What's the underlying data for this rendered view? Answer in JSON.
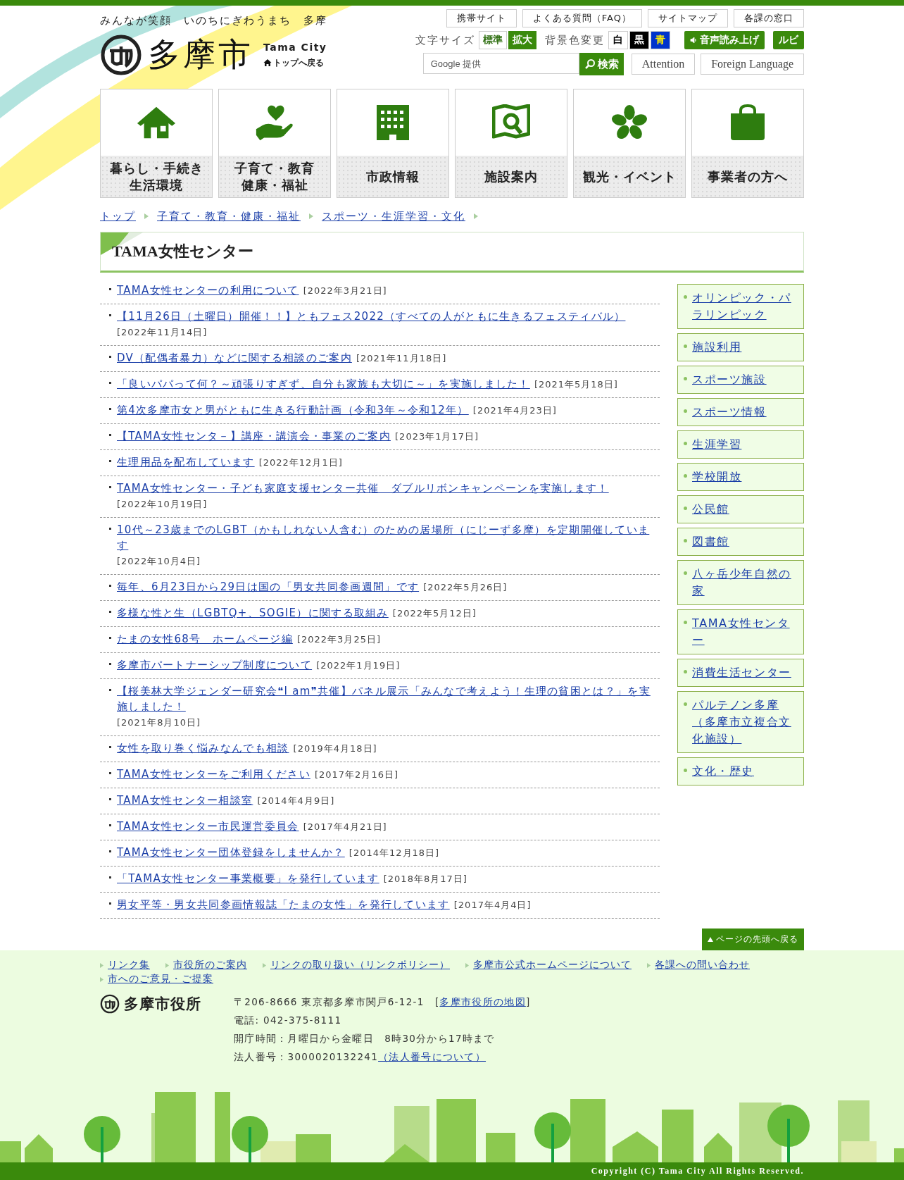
{
  "header": {
    "tagline": "みんなが笑顔　いのちにぎわうまち　多摩",
    "logo_text": "多摩市",
    "logo_sub": "Tama City",
    "home_link": "トップへ戻る",
    "top_links": [
      "携帯サイト",
      "よくある質問（FAQ）",
      "サイトマップ",
      "各課の窓口"
    ],
    "font_size": {
      "label": "文字サイズ",
      "options": [
        {
          "label": "標準",
          "selected": false
        },
        {
          "label": "拡大",
          "selected": true
        }
      ]
    },
    "bg_color": {
      "label": "背景色変更",
      "options": [
        {
          "label": "白",
          "color": "#ffffff"
        },
        {
          "label": "黒",
          "color": "#000000"
        },
        {
          "label": "青",
          "color": "#0033cc"
        }
      ]
    },
    "voice_button": "音声読み上げ",
    "ruby_button": "ルビ",
    "search": {
      "placeholder": "Google 提供",
      "button": "検索"
    },
    "extra_links": [
      "Attention",
      "Foreign Language"
    ]
  },
  "nav": [
    {
      "lines": [
        "暮らし・手続き",
        "生活環境"
      ]
    },
    {
      "lines": [
        "子育て・教育",
        "健康・福祉"
      ]
    },
    {
      "lines": [
        "市政情報"
      ]
    },
    {
      "lines": [
        "施設案内"
      ]
    },
    {
      "lines": [
        "観光・イベント"
      ]
    },
    {
      "lines": [
        "事業者の方へ"
      ]
    }
  ],
  "breadcrumb": [
    "トップ",
    "子育て・教育・健康・福祉",
    "スポーツ・生涯学習・文化"
  ],
  "page_title": "TAMA女性センター",
  "articles": [
    {
      "title": "TAMA女性センターの利用について",
      "date": "[2022年3月21日]"
    },
    {
      "title": "【11月26日（土曜日）開催！！】ともフェス2022（すべての人がともに生きるフェスティバル）",
      "date": "[2022年11月14日]"
    },
    {
      "title": "DV（配偶者暴力）などに関する相談のご案内",
      "date": "[2021年11月18日]"
    },
    {
      "title": "「良いパパって何？～頑張りすぎず、自分も家族も大切に～」を実施しました！",
      "date": "[2021年5月18日]"
    },
    {
      "title": "第4次多摩市女と男がともに生きる行動計画（令和3年～令和12年）",
      "date": "[2021年4月23日]"
    },
    {
      "title": "【TAMA女性センタ－】講座・講演会・事業のご案内",
      "date": "[2023年1月17日]"
    },
    {
      "title": "生理用品を配布しています",
      "date": "[2022年12月1日]"
    },
    {
      "title": "TAMA女性センター・子ども家庭支援センター共催　ダブルリボンキャンペーンを実施します！",
      "date": "[2022年10月19日]"
    },
    {
      "title": "10代～23歳までのLGBT（かもしれない人含む）のための居場所（にじーず多摩）を定期開催しています",
      "date": "[2022年10月4日]"
    },
    {
      "title": "毎年、6月23日から29日は国の「男女共同参画週間」です",
      "date": "[2022年5月26日]"
    },
    {
      "title": "多様な性と生（LGBTQ+、SOGIE）に関する取組み",
      "date": "[2022年5月12日]"
    },
    {
      "title": "たまの女性68号　ホームページ編",
      "date": "[2022年3月25日]"
    },
    {
      "title": "多摩市パートナーシップ制度について",
      "date": "[2022年1月19日]"
    },
    {
      "title": "【桜美林大学ジェンダー研究会❝I am❞共催】パネル展示「みんなで考えよう！生理の貧困とは？」を実施しました！",
      "date": "[2021年8月10日]"
    },
    {
      "title": "女性を取り巻く悩みなんでも相談",
      "date": "[2019年4月18日]"
    },
    {
      "title": "TAMA女性センターをご利用ください",
      "date": "[2017年2月16日]"
    },
    {
      "title": "TAMA女性センター相談室",
      "date": "[2014年4月9日]"
    },
    {
      "title": "TAMA女性センター市民運営委員会",
      "date": "[2017年4月21日]"
    },
    {
      "title": "TAMA女性センター団体登録をしませんか？",
      "date": "[2014年12月18日]"
    },
    {
      "title": "「TAMA女性センター事業概要」を発行しています",
      "date": "[2018年8月17日]"
    },
    {
      "title": "男女平等・男女共同参画情報誌「たまの女性」を発行しています",
      "date": "[2017年4月4日]"
    }
  ],
  "sidebar": [
    "オリンピック・パラリンピック",
    "施設利用",
    "スポーツ施設",
    "スポーツ情報",
    "生涯学習",
    "学校開放",
    "公民館",
    "図書館",
    "八ヶ岳少年自然の家",
    "TAMA女性センター",
    "消費生活センター",
    "パルテノン多摩（多摩市立複合文化施設）",
    "文化・歴史"
  ],
  "back_to_top": "ページの先頭へ戻る",
  "footer": {
    "links": [
      "リンク集",
      "市役所のご案内",
      "リンクの取り扱い（リンクポリシー）",
      "多摩市公式ホームページについて",
      "各課への問い合わせ",
      "市へのご意見・ご提案"
    ],
    "org_name": "多摩市役所",
    "address": "〒206-8666 東京都多摩市関戸6-12-1　",
    "map_open": "[",
    "map_link": "多摩市役所の地図",
    "map_close": "]",
    "phone": "電話: 042-375-8111",
    "hours": "開庁時間：月曜日から金曜日　8時30分から17時まで",
    "corp_number": "法人番号：3000020132241",
    "corp_link": "（法人番号について）",
    "copyright": "Copyright (C) Tama City All Rights Reserved."
  }
}
